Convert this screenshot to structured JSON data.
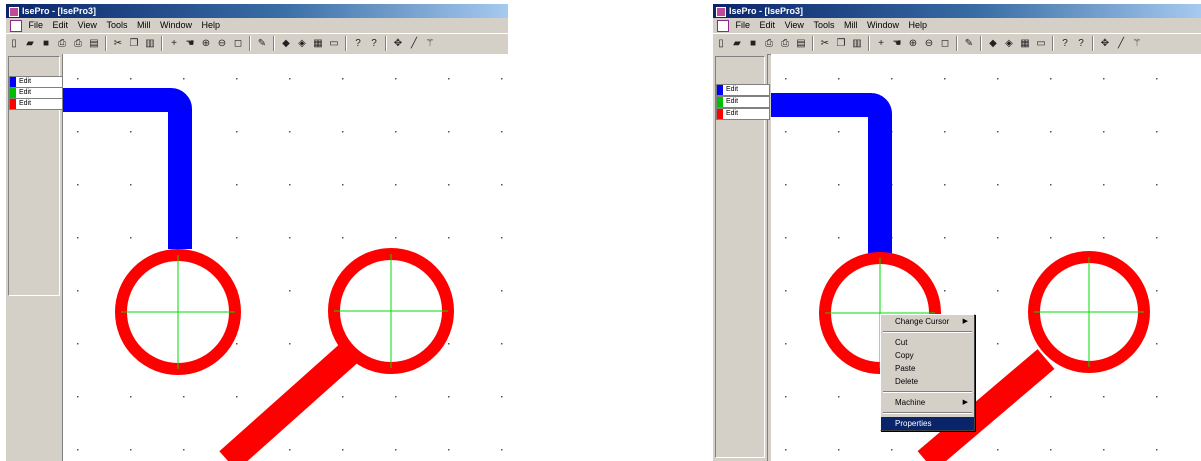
{
  "title": "IsePro - [IsePro3]",
  "menu": [
    "File",
    "Edit",
    "View",
    "Tools",
    "Mill",
    "Window",
    "Help"
  ],
  "layers": [
    {
      "label": "Edit",
      "color": "#0000ff"
    },
    {
      "label": "Edit",
      "color": "#00c000"
    },
    {
      "label": "Edit",
      "color": "#ff0000"
    }
  ],
  "toolbar_icons": [
    "new-icon",
    "open-icon",
    "save-icon",
    "print-preview-icon",
    "print-setup-icon",
    "print-icon",
    "sep",
    "cut-icon",
    "copy-icon",
    "paste-icon",
    "sep",
    "crosshair-icon",
    "hand-icon",
    "zoom-in-icon",
    "zoom-out-icon",
    "zoom-fit-icon",
    "sep",
    "pencil-icon",
    "sep",
    "layer-icon",
    "flip-icon",
    "grid-icon",
    "window-icon",
    "sep",
    "help-icon",
    "context-help-icon",
    "sep",
    "move-icon",
    "line-icon",
    "wand-icon"
  ],
  "toolbar_glyphs": {
    "new-icon": "▯",
    "open-icon": "▰",
    "save-icon": "■",
    "print-preview-icon": "⎙",
    "print-setup-icon": "⎙",
    "print-icon": "▤",
    "cut-icon": "✂",
    "copy-icon": "❐",
    "paste-icon": "▥",
    "crosshair-icon": "+",
    "hand-icon": "☚",
    "zoom-in-icon": "⊕",
    "zoom-out-icon": "⊖",
    "zoom-fit-icon": "◻",
    "pencil-icon": "✎",
    "layer-icon": "◆",
    "flip-icon": "◈",
    "grid-icon": "▦",
    "window-icon": "▭",
    "help-icon": "?",
    "context-help-icon": "?",
    "move-icon": "✥",
    "line-icon": "╱",
    "wand-icon": "⚚"
  },
  "context_menu": {
    "items": [
      {
        "label": "Change Cursor",
        "submenu": true
      },
      {
        "separator": true
      },
      {
        "label": "Cut"
      },
      {
        "label": "Copy"
      },
      {
        "label": "Paste"
      },
      {
        "label": "Delete"
      },
      {
        "separator": true
      },
      {
        "label": "Machine",
        "submenu": true
      },
      {
        "separator": true
      },
      {
        "label": "Properties",
        "selected": true
      }
    ]
  },
  "colors": {
    "trace": "#0000ff",
    "pad_ring": "#ff0000",
    "crosshair": "#00dd00",
    "title_bar": "#0a246a",
    "highlight": "#0a246a"
  }
}
